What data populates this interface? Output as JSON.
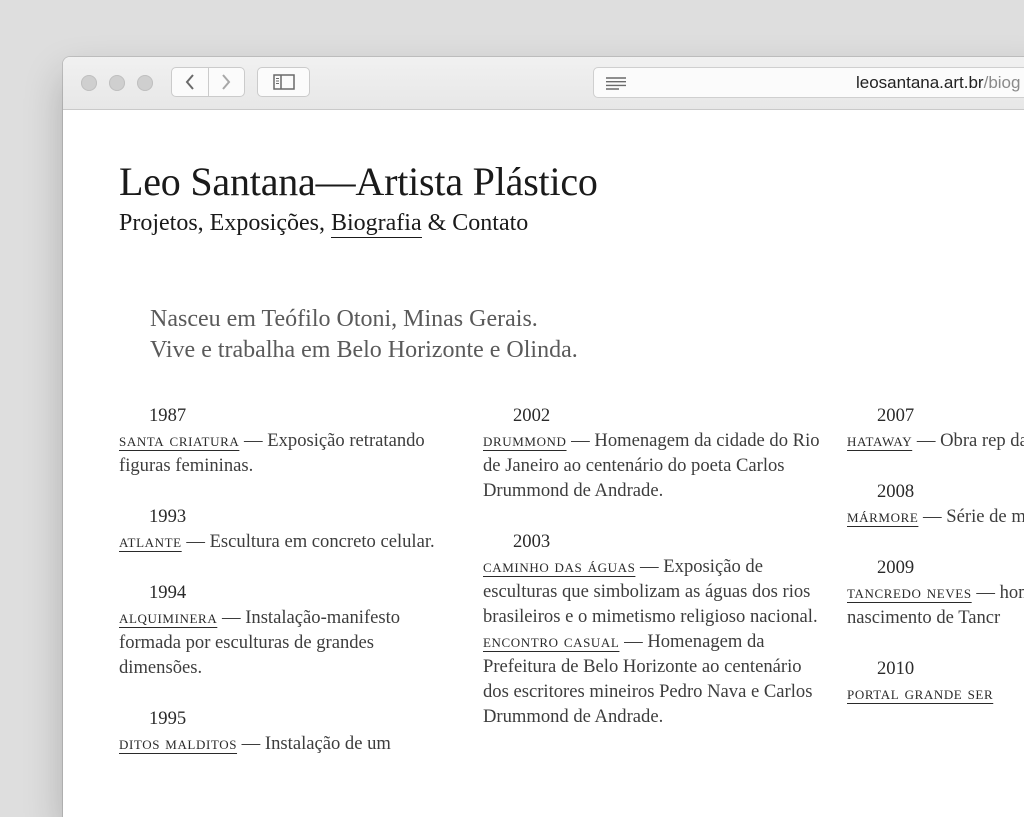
{
  "browser": {
    "address_url_domain": "leosantana.art.br",
    "address_url_path": "/biog",
    "nav_back_icon": "chevron-left-icon",
    "nav_forward_icon": "chevron-right-icon",
    "sidebar_icon": "sidebar-icon",
    "reader_icon": "reader-lines-icon"
  },
  "site": {
    "title": "Leo Santana—Artista Plástico",
    "nav": {
      "projetos": "Projetos",
      "sep1": ", ",
      "exposicoes": "Exposições",
      "sep2": ", ",
      "biografia": "Biografia",
      "sep3": " & ",
      "contato": "Contato"
    },
    "intro_line1": "Nasceu em Teófilo Otoni, Minas Gerais.",
    "intro_line2": "Vive e trabalha em Belo Horizonte e Olinda."
  },
  "columns": [
    [
      {
        "year": "1987",
        "items": [
          {
            "title": "santa criatura",
            "desc": " — Exposição retratando figuras femininas."
          }
        ]
      },
      {
        "year": "1993",
        "items": [
          {
            "title": "atlante",
            "desc": " — Escultura em concreto celular."
          }
        ]
      },
      {
        "year": "1994",
        "items": [
          {
            "title": "alquiminera",
            "desc": " — Instalação-manifesto formada por esculturas de grandes dimensões."
          }
        ]
      },
      {
        "year": "1995",
        "items": [
          {
            "title": "ditos malditos",
            "desc": " — Instalação de um"
          }
        ]
      }
    ],
    [
      {
        "year": "2002",
        "items": [
          {
            "title": "drummond",
            "desc": " — Homenagem da cidade do Rio de Janeiro ao centenário do poeta Carlos Drummond de Andrade."
          }
        ]
      },
      {
        "year": "2003",
        "items": [
          {
            "title": "caminho das águas",
            "desc": " — Exposição de esculturas que simbolizam as águas dos rios brasileiros e o mimetismo religioso nacional."
          },
          {
            "title": "encontro casual",
            "desc": " — Homenagem da Prefeitura de Belo Horizonte ao centenário dos escritores mineiros Pedro Nava e Carlos Drummond de Andrade."
          }
        ]
      }
    ],
    [
      {
        "year": "2007",
        "items": [
          {
            "title": "hataway",
            "desc": " — Obra rep da Nação Carajá."
          }
        ]
      },
      {
        "year": "2008",
        "items": [
          {
            "title": "mármore",
            "desc": " — Série de mármore branco."
          }
        ]
      },
      {
        "year": "2009",
        "items": [
          {
            "title": "tancredo neves",
            "desc": " — homenagem ao cente nascimento de Tancr"
          }
        ]
      },
      {
        "year": "2010",
        "items": [
          {
            "title": "portal grande ser",
            "desc": ""
          }
        ]
      }
    ]
  ]
}
